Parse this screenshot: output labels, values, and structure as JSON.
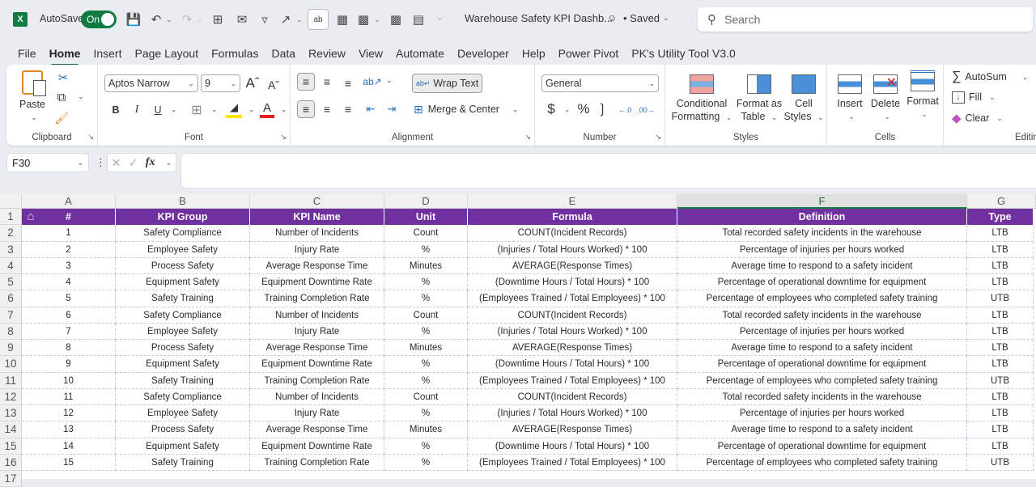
{
  "titlebar": {
    "autosave_label": "AutoSave",
    "autosave_state": "On",
    "document_title": "Warehouse Safety KPI Dashb...",
    "save_status": "• Saved",
    "search_placeholder": "Search"
  },
  "menu_tabs": [
    "File",
    "Home",
    "Insert",
    "Page Layout",
    "Formulas",
    "Data",
    "Review",
    "View",
    "Automate",
    "Developer",
    "Help",
    "Power Pivot",
    "PK's Utility Tool V3.0"
  ],
  "active_tab": "Home",
  "ribbon": {
    "clipboard": {
      "label": "Clipboard",
      "paste": "Paste"
    },
    "font": {
      "label": "Font",
      "font_name": "Aptos Narrow",
      "font_size": "9",
      "bold": "B",
      "italic": "I",
      "underline": "U"
    },
    "alignment": {
      "label": "Alignment",
      "wrap_text": "Wrap Text",
      "merge_center": "Merge & Center"
    },
    "number": {
      "label": "Number",
      "format": "General",
      "currency": "$",
      "percent": "%",
      "comma": "9"
    },
    "styles": {
      "label": "Styles",
      "conditional_formatting_1": "Conditional",
      "conditional_formatting_2": "Formatting",
      "format_as_table_1": "Format as",
      "format_as_table_2": "Table",
      "cell_styles_1": "Cell",
      "cell_styles_2": "Styles"
    },
    "cells": {
      "label": "Cells",
      "insert": "Insert",
      "delete": "Delete",
      "format": "Format"
    },
    "editing": {
      "label": "Editing",
      "autosum": "AutoSum",
      "fill": "Fill",
      "clear": "Clear"
    }
  },
  "formula_bar": {
    "name_box": "F30",
    "fx": "fx",
    "formula": ""
  },
  "sheet": {
    "columns": [
      "A",
      "B",
      "C",
      "D",
      "E",
      "F",
      "G"
    ],
    "selected_column": "F",
    "header_color": "#7030a0",
    "headers": [
      "#",
      "KPI Group",
      "KPI Name",
      "Unit",
      "Formula",
      "Definition",
      "Type"
    ],
    "rows": [
      [
        "1",
        "Safety Compliance",
        "Number of Incidents",
        "Count",
        "COUNT(Incident Records)",
        "Total recorded safety incidents in the warehouse",
        "LTB"
      ],
      [
        "2",
        "Employee Safety",
        "Injury Rate",
        "%",
        "(Injuries / Total Hours Worked) * 100",
        "Percentage of injuries per hours worked",
        "LTB"
      ],
      [
        "3",
        "Process Safety",
        "Average Response Time",
        "Minutes",
        "AVERAGE(Response Times)",
        "Average time to respond to a safety incident",
        "LTB"
      ],
      [
        "4",
        "Equipment Safety",
        "Equipment Downtime Rate",
        "%",
        "(Downtime Hours / Total Hours) * 100",
        "Percentage of operational downtime for equipment",
        "LTB"
      ],
      [
        "5",
        "Safety Training",
        "Training Completion Rate",
        "%",
        "(Employees Trained / Total Employees) * 100",
        "Percentage of employees who completed safety training",
        "UTB"
      ],
      [
        "6",
        "Safety Compliance",
        "Number of Incidents",
        "Count",
        "COUNT(Incident Records)",
        "Total recorded safety incidents in the warehouse",
        "LTB"
      ],
      [
        "7",
        "Employee Safety",
        "Injury Rate",
        "%",
        "(Injuries / Total Hours Worked) * 100",
        "Percentage of injuries per hours worked",
        "LTB"
      ],
      [
        "8",
        "Process Safety",
        "Average Response Time",
        "Minutes",
        "AVERAGE(Response Times)",
        "Average time to respond to a safety incident",
        "LTB"
      ],
      [
        "9",
        "Equipment Safety",
        "Equipment Downtime Rate",
        "%",
        "(Downtime Hours / Total Hours) * 100",
        "Percentage of operational downtime for equipment",
        "LTB"
      ],
      [
        "10",
        "Safety Training",
        "Training Completion Rate",
        "%",
        "(Employees Trained / Total Employees) * 100",
        "Percentage of employees who completed safety training",
        "UTB"
      ],
      [
        "11",
        "Safety Compliance",
        "Number of Incidents",
        "Count",
        "COUNT(Incident Records)",
        "Total recorded safety incidents in the warehouse",
        "LTB"
      ],
      [
        "12",
        "Employee Safety",
        "Injury Rate",
        "%",
        "(Injuries / Total Hours Worked) * 100",
        "Percentage of injuries per hours worked",
        "LTB"
      ],
      [
        "13",
        "Process Safety",
        "Average Response Time",
        "Minutes",
        "AVERAGE(Response Times)",
        "Average time to respond to a safety incident",
        "LTB"
      ],
      [
        "14",
        "Equipment Safety",
        "Equipment Downtime Rate",
        "%",
        "(Downtime Hours / Total Hours) * 100",
        "Percentage of operational downtime for equipment",
        "LTB"
      ],
      [
        "15",
        "Safety Training",
        "Training Completion Rate",
        "%",
        "(Employees Trained / Total Employees) * 100",
        "Percentage of employees who completed safety training",
        "UTB"
      ]
    ],
    "row_numbers": [
      "1",
      "2",
      "3",
      "4",
      "5",
      "6",
      "7",
      "8",
      "9",
      "10",
      "11",
      "12",
      "13",
      "14",
      "15",
      "16",
      "17"
    ]
  }
}
